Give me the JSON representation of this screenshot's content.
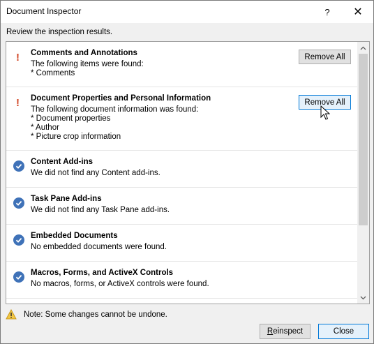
{
  "window": {
    "title": "Document Inspector",
    "help_glyph": "?",
    "close_glyph": "✕"
  },
  "subtitle": "Review the inspection results.",
  "results": [
    {
      "status": "warning",
      "heading": "Comments and Annotations",
      "description": [
        "The following items were found:",
        "* Comments"
      ],
      "action": "Remove All"
    },
    {
      "status": "warning",
      "heading": "Document Properties and Personal Information",
      "description": [
        "The following document information was found:",
        "* Document properties",
        "* Author",
        "* Picture crop information"
      ],
      "action": "Remove All"
    },
    {
      "status": "ok",
      "heading": "Content Add-ins",
      "description": [
        "We did not find any Content add-ins."
      ]
    },
    {
      "status": "ok",
      "heading": "Task Pane Add-ins",
      "description": [
        "We did not find any Task Pane add-ins."
      ]
    },
    {
      "status": "ok",
      "heading": "Embedded Documents",
      "description": [
        "No embedded documents were found."
      ]
    },
    {
      "status": "ok",
      "heading": "Macros, Forms, and ActiveX Controls",
      "description": [
        "No macros, forms, or ActiveX controls were found."
      ]
    }
  ],
  "footer": {
    "note": "Note: Some changes cannot be undone.",
    "reinspect_label": "Reinspect",
    "reinspect_mnemonic": "R",
    "close_label": "Close"
  },
  "colors": {
    "warning": "#d24726",
    "ok": "#3f72b8",
    "focus_border": "#0078d7"
  }
}
